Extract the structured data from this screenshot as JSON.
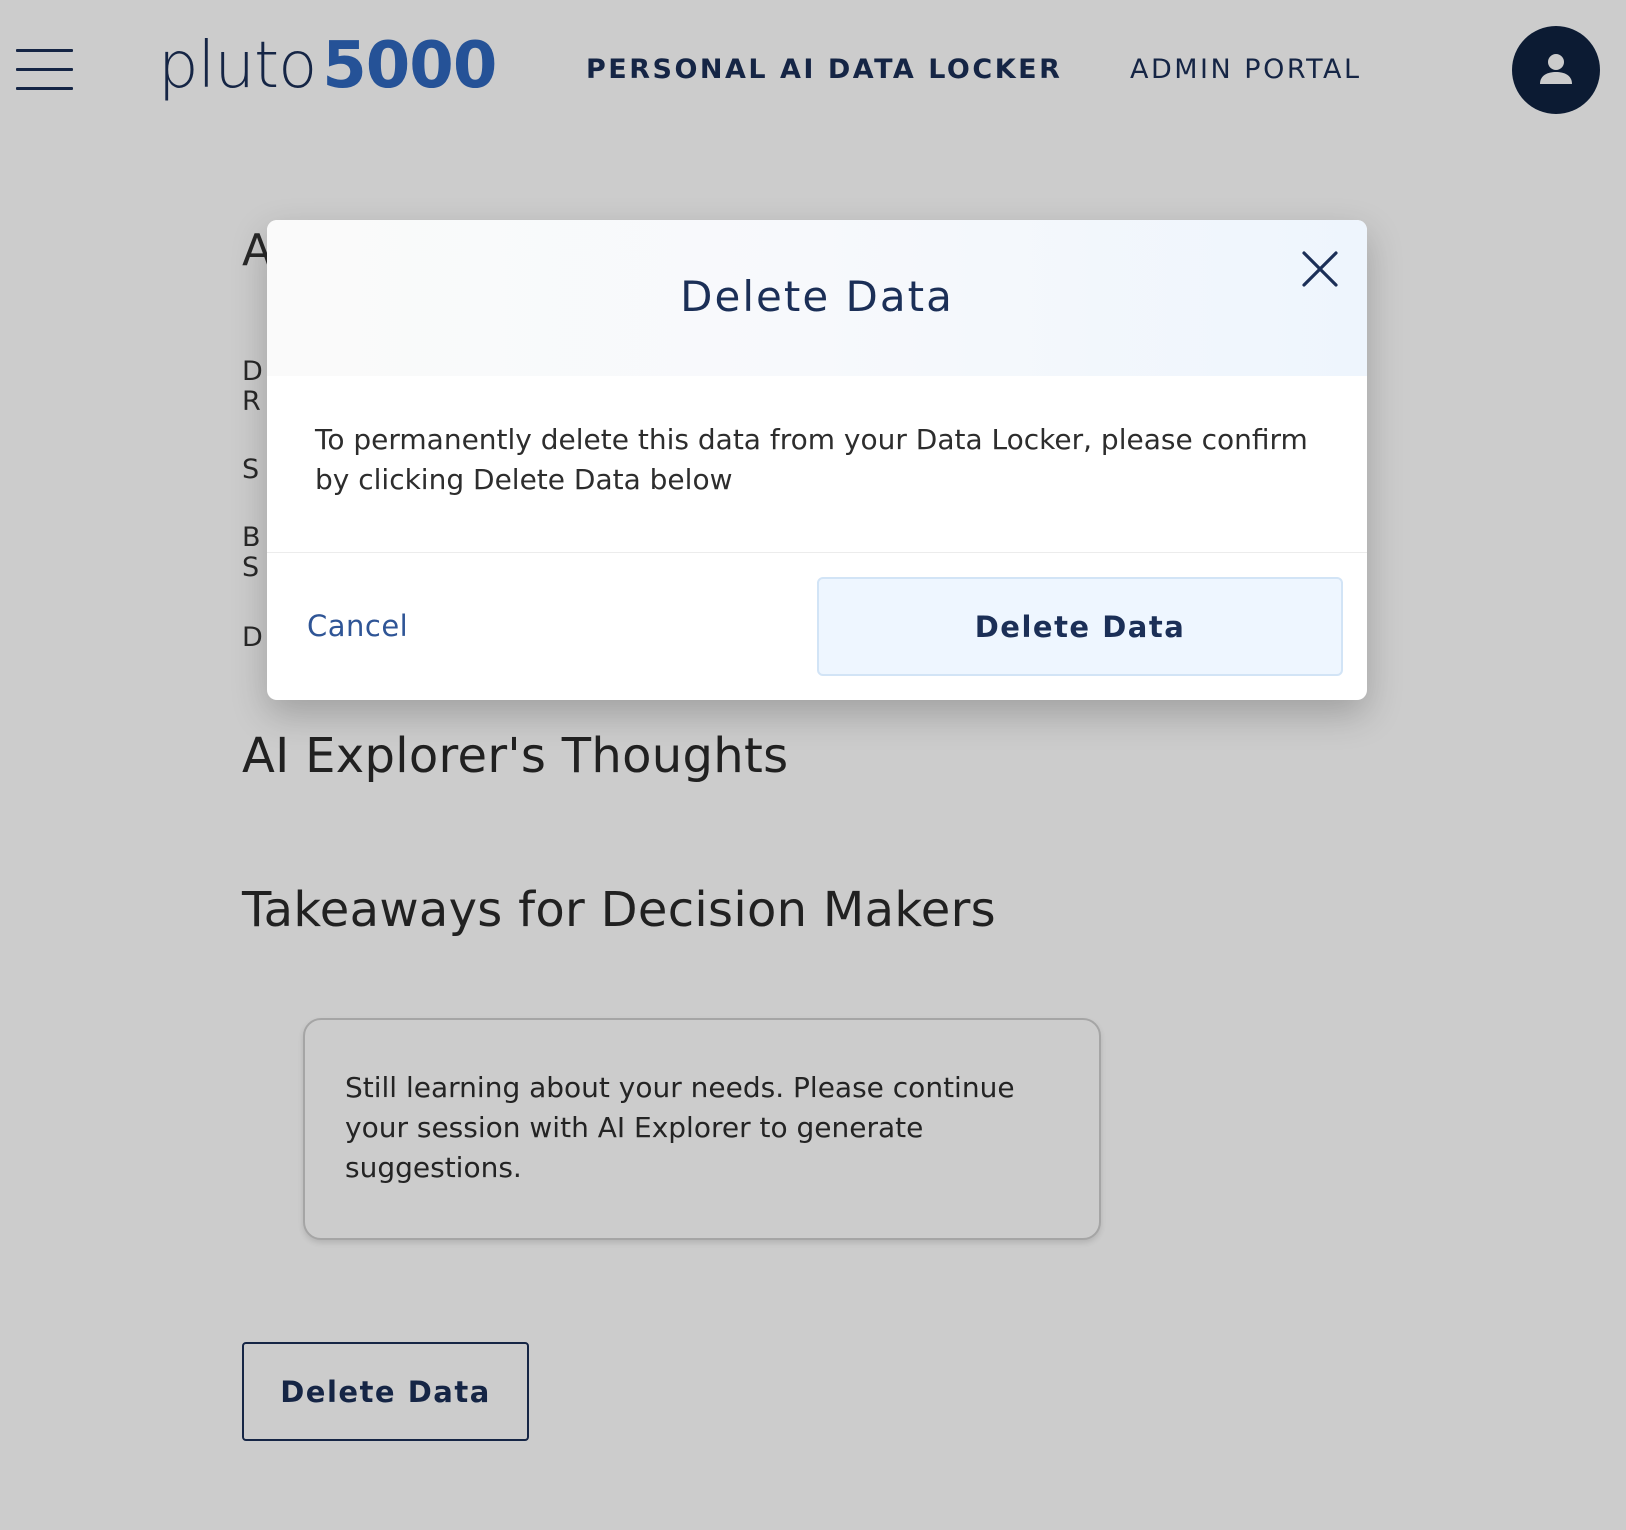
{
  "header": {
    "logo_word": "pluto",
    "logo_number": "5000",
    "nav_primary": "PERSONAL AI DATA LOCKER",
    "nav_secondary": "ADMIN PORTAL",
    "icons": {
      "menu": "hamburger-menu-icon",
      "user": "user-avatar-icon"
    }
  },
  "page": {
    "partial_heading": "A",
    "partial_list": [
      "D",
      "R",
      "S",
      "B",
      "S",
      "D"
    ],
    "thoughts_heading": "AI Explorer's Thoughts",
    "takeaways_heading": "Takeaways for Decision Makers",
    "takeaway_card_text": "Still learning about your needs. Please continue your session with AI Explorer to generate suggestions.",
    "delete_button": "Delete Data"
  },
  "modal": {
    "title": "Delete Data",
    "body": "To permanently delete this data from your Data Locker, please confirm by clicking Delete Data below",
    "cancel_label": "Cancel",
    "confirm_label": "Delete Data",
    "close_icon": "close-icon"
  },
  "colors": {
    "brand_navy": "#1b2f57",
    "brand_blue": "#2f67bd",
    "overlay": "rgba(0,0,0,0.2)",
    "confirm_bg": "#eef6ff"
  }
}
